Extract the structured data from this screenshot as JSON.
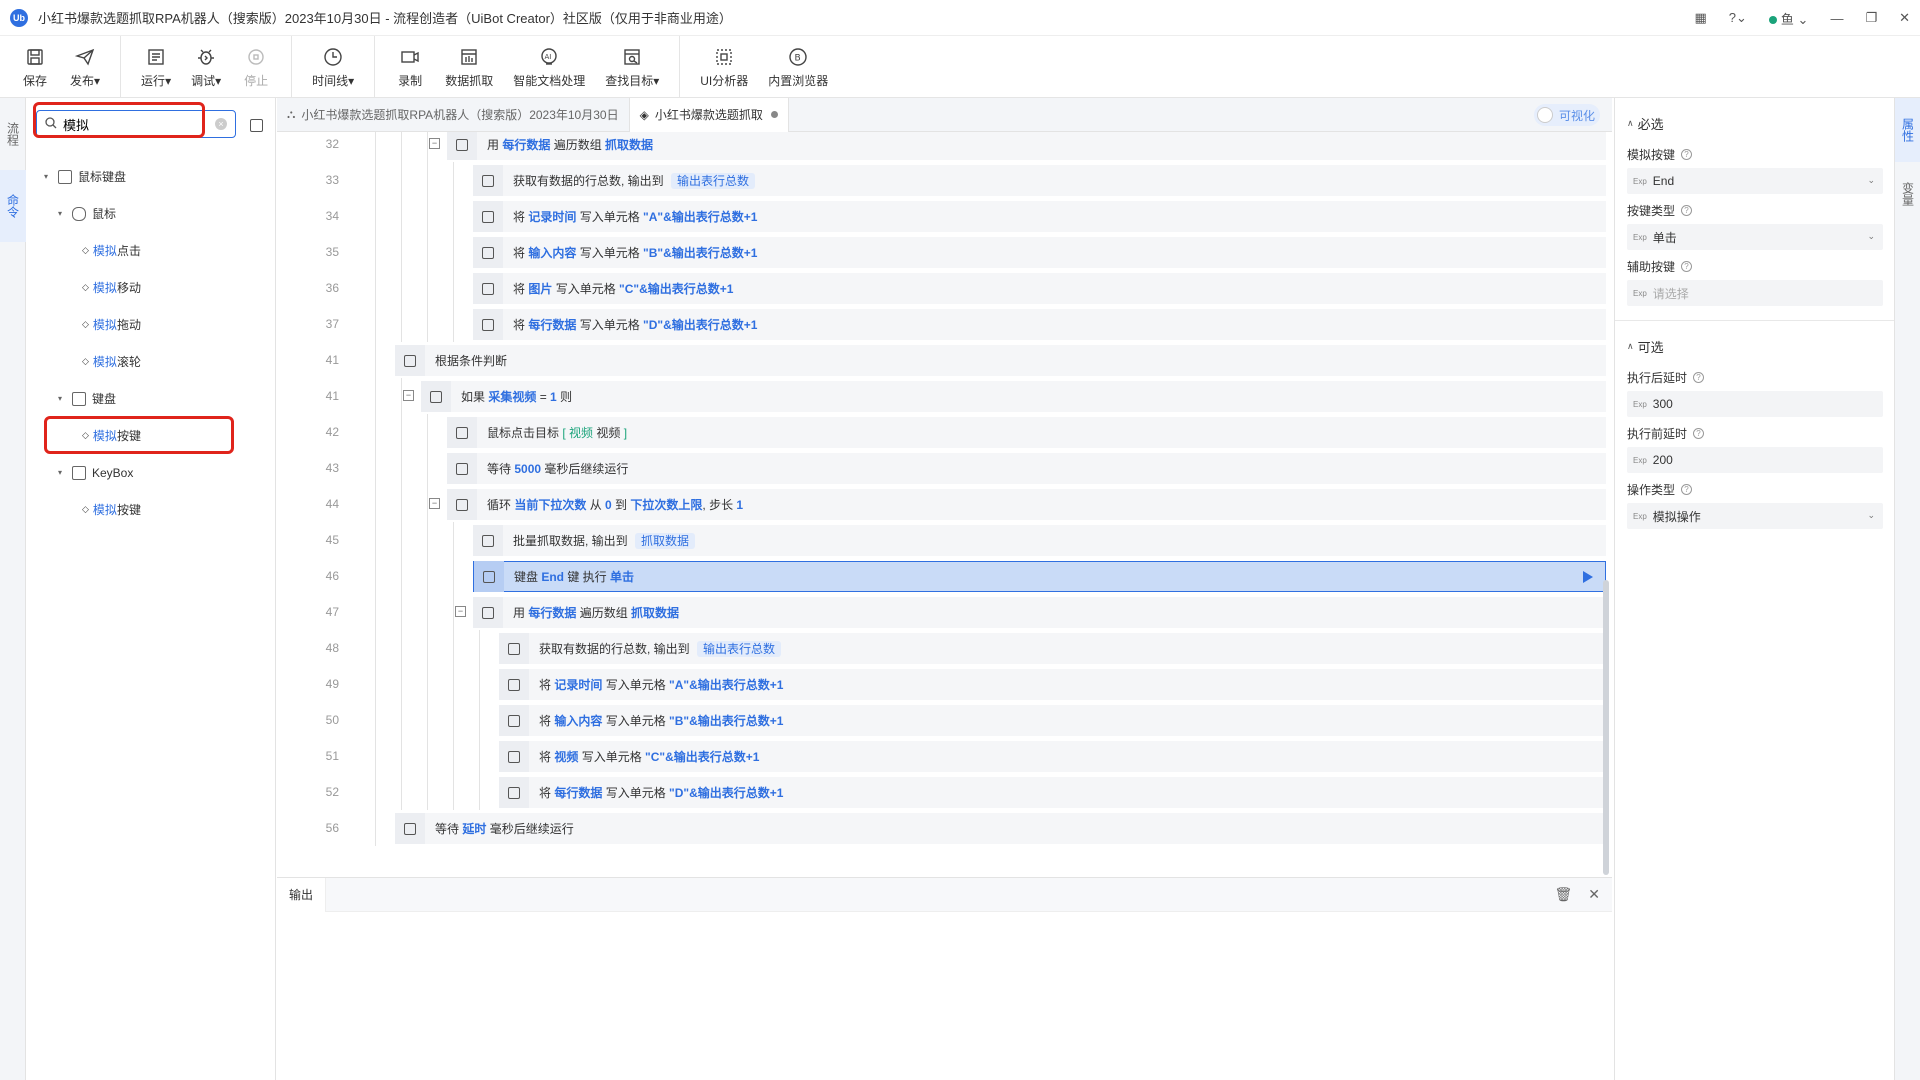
{
  "window": {
    "title": "小红书爆款选题抓取RPA机器人（搜索版）2023年10月30日 - 流程创造者（UiBot Creator）社区版（仅用于非商业用途）",
    "logo_text": "Ub",
    "user": "鱼"
  },
  "toolbar": {
    "save": "保存",
    "publish": "发布",
    "run": "运行",
    "debug": "调试",
    "stop": "停止",
    "timeline": "时间线",
    "record": "录制",
    "data_capture": "数据抓取",
    "ai_doc": "智能文档处理",
    "find_target": "查找目标",
    "ui_analyzer": "UI分析器",
    "builtin_browser": "内置浏览器"
  },
  "left_strip": {
    "tab1": "流程",
    "tab2": "命令"
  },
  "search": {
    "value": "模拟",
    "placeholder": ""
  },
  "tree": {
    "mk": "鼠标键盘",
    "mouse": "鼠标",
    "mouse_items": [
      {
        "hl": "模拟",
        "rest": "点击"
      },
      {
        "hl": "模拟",
        "rest": "移动"
      },
      {
        "hl": "模拟",
        "rest": "拖动"
      },
      {
        "hl": "模拟",
        "rest": "滚轮"
      }
    ],
    "keyboard": "键盘",
    "keyboard_item": {
      "hl": "模拟",
      "rest": "按键"
    },
    "keybox": "KeyBox",
    "keybox_item": {
      "hl": "模拟",
      "rest": "按键"
    }
  },
  "tabs": {
    "tab1": "小红书爆款选题抓取RPA机器人（搜索版）2023年10月30日",
    "tab2": "小红书爆款选题抓取",
    "visualize": "可视化"
  },
  "code": [
    {
      "ln": "32",
      "segs": [
        [
          "用 ",
          ""
        ],
        [
          "每行数据",
          "v"
        ],
        [
          " 遍历数组 ",
          ""
        ],
        [
          "抓取数据",
          "v"
        ]
      ]
    },
    {
      "ln": "33",
      "segs": [
        [
          "获取有数据的行总数, 输出到 ",
          ""
        ],
        [
          "输出表行总数",
          "pill"
        ]
      ]
    },
    {
      "ln": "34",
      "segs": [
        [
          "将 ",
          ""
        ],
        [
          "记录时间",
          "v"
        ],
        [
          " 写入单元格 ",
          ""
        ],
        [
          "\"A\"&输出表行总数+1",
          "v"
        ]
      ]
    },
    {
      "ln": "35",
      "segs": [
        [
          "将 ",
          ""
        ],
        [
          "输入内容",
          "v"
        ],
        [
          " 写入单元格 ",
          ""
        ],
        [
          "\"B\"&输出表行总数+1",
          "v"
        ]
      ]
    },
    {
      "ln": "36",
      "segs": [
        [
          "将 ",
          ""
        ],
        [
          "图片",
          "v"
        ],
        [
          " 写入单元格 ",
          ""
        ],
        [
          "\"C\"&输出表行总数+1",
          "v"
        ]
      ]
    },
    {
      "ln": "37",
      "segs": [
        [
          "将 ",
          ""
        ],
        [
          "每行数据",
          "v"
        ],
        [
          " 写入单元格 ",
          ""
        ],
        [
          "\"D\"&输出表行总数+1",
          "v"
        ]
      ]
    },
    {
      "ln": "41",
      "segs": [
        [
          "根据条件判断",
          ""
        ]
      ]
    },
    {
      "ln": "41",
      "segs": [
        [
          "如果 ",
          ""
        ],
        [
          "采集视频",
          "v"
        ],
        [
          " = ",
          ""
        ],
        [
          "1",
          "v"
        ],
        [
          " 则",
          ""
        ]
      ]
    },
    {
      "ln": "42",
      "segs": [
        [
          "鼠标点击目标 ",
          ""
        ],
        [
          "[ 视频",
          "tag"
        ],
        [
          " 视频 ",
          ""
        ],
        [
          "]",
          "tag"
        ]
      ]
    },
    {
      "ln": "43",
      "segs": [
        [
          "等待 ",
          ""
        ],
        [
          "5000",
          "v"
        ],
        [
          " 毫秒后继续运行",
          ""
        ]
      ]
    },
    {
      "ln": "44",
      "segs": [
        [
          "循环 ",
          ""
        ],
        [
          "当前下拉次数",
          "v"
        ],
        [
          " 从 ",
          ""
        ],
        [
          "0",
          "v"
        ],
        [
          " 到 ",
          ""
        ],
        [
          "下拉次数上限",
          "v"
        ],
        [
          ", 步长 ",
          ""
        ],
        [
          "1",
          "v"
        ]
      ]
    },
    {
      "ln": "45",
      "segs": [
        [
          "批量抓取数据, 输出到 ",
          ""
        ],
        [
          "抓取数据",
          "pill"
        ]
      ]
    },
    {
      "ln": "46",
      "segs": [
        [
          "键盘 ",
          ""
        ],
        [
          "End",
          "v"
        ],
        [
          " 键 执行 ",
          ""
        ],
        [
          "单击",
          "v"
        ]
      ]
    },
    {
      "ln": "47",
      "segs": [
        [
          "用 ",
          ""
        ],
        [
          "每行数据",
          "v"
        ],
        [
          " 遍历数组 ",
          ""
        ],
        [
          "抓取数据",
          "v"
        ]
      ]
    },
    {
      "ln": "48",
      "segs": [
        [
          "获取有数据的行总数, 输出到 ",
          ""
        ],
        [
          "输出表行总数",
          "pill"
        ]
      ]
    },
    {
      "ln": "49",
      "segs": [
        [
          "将 ",
          ""
        ],
        [
          "记录时间",
          "v"
        ],
        [
          " 写入单元格 ",
          ""
        ],
        [
          "\"A\"&输出表行总数+1",
          "v"
        ]
      ]
    },
    {
      "ln": "50",
      "segs": [
        [
          "将 ",
          ""
        ],
        [
          "输入内容",
          "v"
        ],
        [
          " 写入单元格 ",
          ""
        ],
        [
          "\"B\"&输出表行总数+1",
          "v"
        ]
      ]
    },
    {
      "ln": "51",
      "segs": [
        [
          "将 ",
          ""
        ],
        [
          "视频",
          "v"
        ],
        [
          " 写入单元格 ",
          ""
        ],
        [
          "\"C\"&输出表行总数+1",
          "v"
        ]
      ]
    },
    {
      "ln": "52",
      "segs": [
        [
          "将 ",
          ""
        ],
        [
          "每行数据",
          "v"
        ],
        [
          " 写入单元格 ",
          ""
        ],
        [
          "\"D\"&输出表行总数+1",
          "v"
        ]
      ]
    },
    {
      "ln": "56",
      "segs": [
        [
          "等待 ",
          ""
        ],
        [
          "延时",
          "v"
        ],
        [
          " 毫秒后继续运行",
          ""
        ]
      ]
    }
  ],
  "output": {
    "tab": "输出"
  },
  "props": {
    "required": "必选",
    "key_label": "模拟按键",
    "key_value": "End",
    "keytype_label": "按键类型",
    "keytype_value": "单击",
    "aux_label": "辅助按键",
    "aux_placeholder": "请选择",
    "optional": "可选",
    "after_label": "执行后延时",
    "after_value": "300",
    "before_label": "执行前延时",
    "before_value": "200",
    "optype_label": "操作类型",
    "optype_value": "模拟操作",
    "exp": "Exp"
  },
  "right_strip": {
    "tab1": "属性",
    "tab2": "变量"
  },
  "colors": {
    "accent": "#2f6fe0",
    "highlight_box": "#e0241b",
    "selected_row": "#c9dbf7"
  }
}
